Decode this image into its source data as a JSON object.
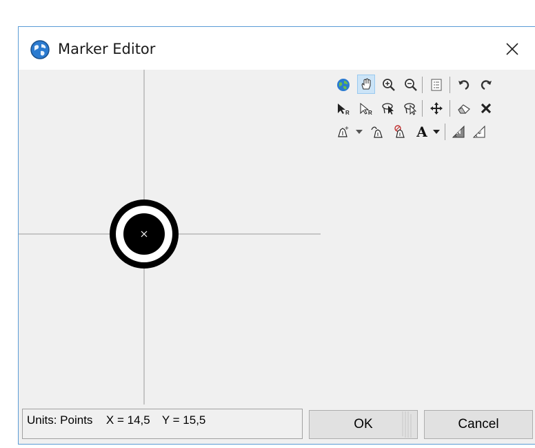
{
  "window": {
    "title": "Marker Editor"
  },
  "status_bar": {
    "units_label": "Units: Points",
    "x_label": "X = 14,5",
    "y_label": "Y = 15,5"
  },
  "buttons": {
    "ok": "OK",
    "cancel": "Cancel"
  },
  "toolbar": {
    "row1": [
      "globe-icon",
      "pan-hand-icon",
      "zoom-in-icon",
      "zoom-out-icon",
      "properties-icon",
      "undo-icon",
      "redo-icon"
    ],
    "row2": [
      "select-arrow-icon",
      "select-arrow-outline-icon",
      "lasso-select-icon",
      "lasso-select-outline-icon",
      "move-icon",
      "eraser-icon",
      "delete-icon"
    ],
    "row3": [
      "pen-add-icon",
      "dropdown-icon",
      "pen-edit-icon",
      "pen-style-icon",
      "text-icon",
      "dropdown-icon",
      "ruler-icon",
      "ruler-outline-icon"
    ],
    "active_tool": "pan-hand-icon",
    "text_tool_glyph": "A"
  },
  "colors": {
    "accent": "#5a9bd5",
    "globe": "#2b7bd0",
    "marker": "#000000"
  }
}
